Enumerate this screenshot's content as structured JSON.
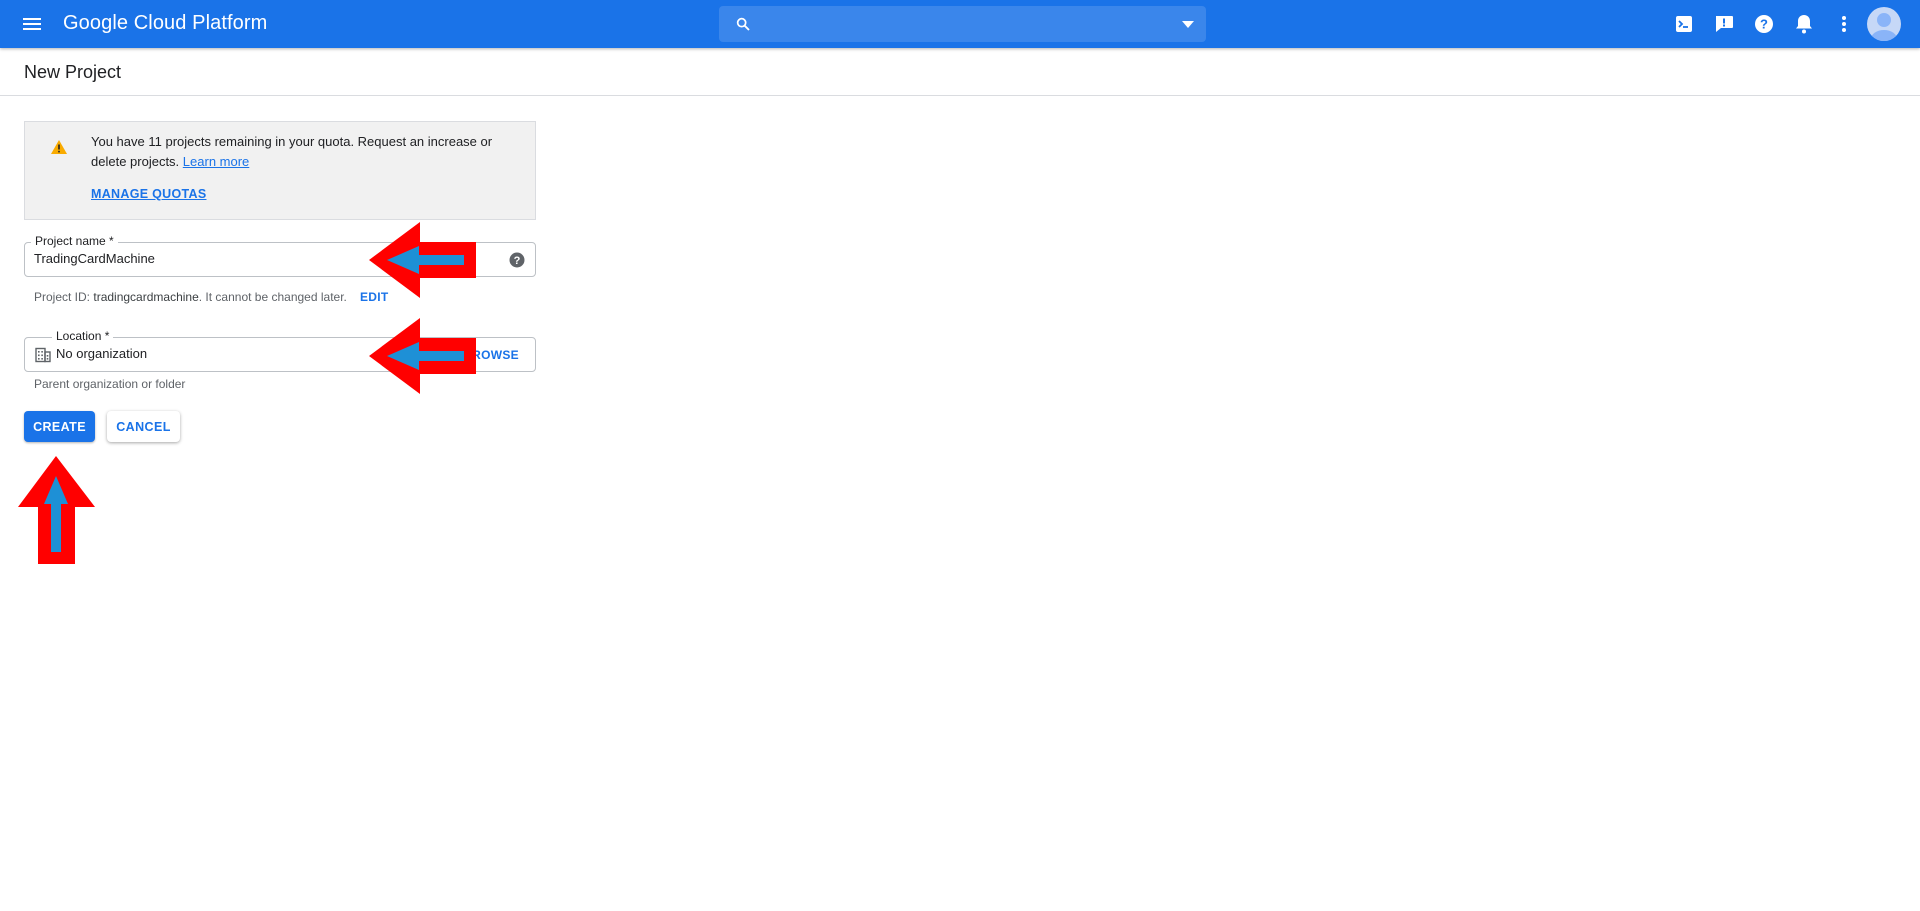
{
  "topbar": {
    "brand": "Google Cloud Platform",
    "icons": [
      "menu-icon",
      "search-icon",
      "dropdown-icon",
      "cloud-shell-icon",
      "feedback-icon",
      "help-icon",
      "notifications-icon",
      "more-vert-icon",
      "avatar"
    ]
  },
  "page": {
    "title": "New Project"
  },
  "notice": {
    "text": "You have 11 projects remaining in your quota. Request an increase or delete projects.",
    "learn_more": "Learn more",
    "manage_quotas": "MANAGE QUOTAS"
  },
  "project_name": {
    "label": "Project name *",
    "value": "TradingCardMachine",
    "hint_prefix": "Project ID:",
    "project_id": "tradingcardmachine",
    "hint_suffix": ". It cannot be changed later.",
    "edit": "EDIT"
  },
  "location": {
    "label": "Location *",
    "value": "No organization",
    "browse": "BROWSE",
    "hint": "Parent organization or folder"
  },
  "actions": {
    "create": "CREATE",
    "cancel": "CANCEL"
  },
  "colors": {
    "topbar": "#1a73e8",
    "link": "#1a73e8",
    "annotation_arrow": "#ff0000",
    "annotation_arrow_inner": "#1e90d6"
  }
}
